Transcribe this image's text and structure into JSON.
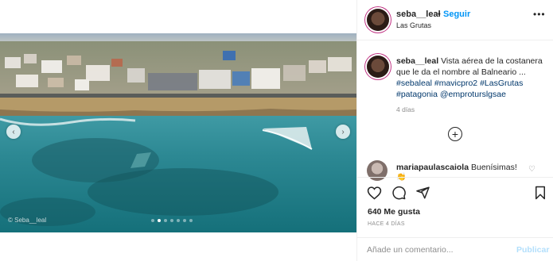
{
  "post": {
    "watermark": "© Seba__leal",
    "carousel": {
      "slide_count": 7,
      "active_index": 1
    },
    "nav_prev_glyph": "‹",
    "nav_next_glyph": "›"
  },
  "header": {
    "username": "seba__leal",
    "separator": "•",
    "follow_label": "Seguir",
    "location": "Las Grutas",
    "more_glyph": "•••"
  },
  "caption": {
    "username": "seba__leal",
    "text_line1": "Vista aérea de la costanera",
    "text_line2": "que le da el nombre al Balneario ...",
    "tags_line3": [
      "#sebaleal",
      "#mavicpro2",
      "#LasGrutas"
    ],
    "tags_line4": [
      "#patagonia",
      "@emproturslgsae"
    ],
    "time": "4 días"
  },
  "load_more_glyph": "+",
  "comment": {
    "username": "mariapaulascaiola",
    "text": "Buenísimas!",
    "emoji": "👏",
    "heart_glyph": "♡"
  },
  "actions": {
    "likes": "640 Me gusta",
    "post_time": "HACE 4 DÍAS"
  },
  "add_comment": {
    "placeholder": "Añade un comentario...",
    "publish_label": "Publicar"
  },
  "icons": {
    "like": "heart-outline-icon",
    "comment": "speech-bubble-icon",
    "share": "paper-plane-icon",
    "save": "bookmark-icon"
  },
  "colors": {
    "link_blue": "#0095f6",
    "hashtag": "#00376b",
    "muted": "#8e8e8e",
    "publish_disabled": "#b2dffc"
  }
}
